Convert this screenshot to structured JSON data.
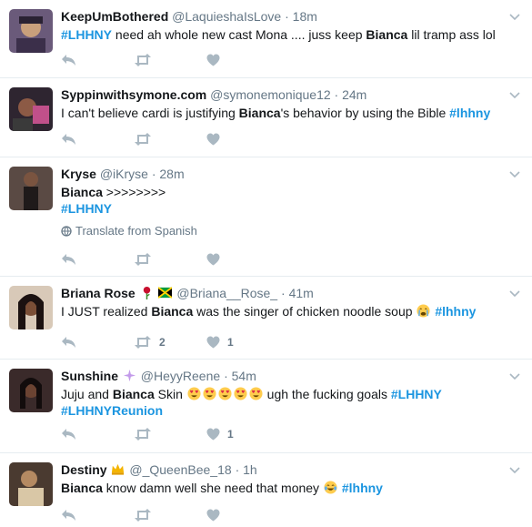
{
  "tweets": [
    {
      "name": "KeepUmBothered",
      "handle": "@LaquieshaIsLove",
      "time": "18m",
      "text": [
        {
          "t": "#LHHNY",
          "c": "hashtag"
        },
        {
          "t": " need ah whole new cast Mona .... juss keep "
        },
        {
          "t": "Bianca",
          "c": "b"
        },
        {
          "t": " lil tramp ass lol"
        }
      ],
      "retweets": "",
      "likes": ""
    },
    {
      "name": "Syppinwithsymone.com",
      "handle": "@symonemonique12",
      "time": "24m",
      "text": [
        {
          "t": "I can't believe cardi is justifying "
        },
        {
          "t": "Bianca",
          "c": "b"
        },
        {
          "t": "'s behavior by using the Bible "
        },
        {
          "t": "#lhhny",
          "c": "hashtag"
        }
      ],
      "retweets": "",
      "likes": ""
    },
    {
      "name": "Kryse",
      "handle": "@iKryse",
      "time": "28m",
      "text_line1": "Bianca",
      "text_line1_rest": " >>>>>>>>",
      "text_line2": "#LHHNY",
      "translate_label": "Translate from Spanish",
      "retweets": "",
      "likes": ""
    },
    {
      "name": "Briana Rose",
      "handle": "@Briana__Rose_",
      "time": "41m",
      "text": [
        {
          "t": "I JUST realized "
        },
        {
          "t": "Bianca",
          "c": "b"
        },
        {
          "t": " was the singer of chicken noodle soup "
        },
        {
          "emoji": "crying"
        },
        {
          "t": " "
        },
        {
          "t": "#lhhny",
          "c": "hashtag"
        }
      ],
      "retweets": "2",
      "likes": "1"
    },
    {
      "name": "Sunshine",
      "handle": "@HeyyReene",
      "time": "54m",
      "text_line1": [
        {
          "t": "Juju and "
        },
        {
          "t": "Bianca",
          "c": "b"
        },
        {
          "t": " Skin "
        },
        {
          "emoji": "hearteyes"
        },
        {
          "emoji": "hearteyes"
        },
        {
          "emoji": "hearteyes"
        },
        {
          "emoji": "hearteyes"
        },
        {
          "emoji": "hearteyes"
        },
        {
          "t": " ugh the fucking goals "
        },
        {
          "t": "#LHHNY",
          "c": "hashtag"
        }
      ],
      "text_line2": "#LHHNYReunion",
      "retweets": "",
      "likes": "1"
    },
    {
      "name": "Destiny",
      "handle": "@_QueenBee_18",
      "time": "1h",
      "text": [
        {
          "t": "Bianca",
          "c": "b"
        },
        {
          "t": " know damn well she need that money "
        },
        {
          "emoji": "laughing"
        },
        {
          "t": " "
        },
        {
          "t": "#lhhny",
          "c": "hashtag"
        }
      ],
      "retweets": "",
      "likes": ""
    }
  ],
  "colors": {
    "hashtag": "#1b95e0",
    "action": "#aab8c2",
    "divider": "#e6ecf0"
  },
  "icons": [
    "reply-icon",
    "retweet-icon",
    "like-icon",
    "caret-down-icon",
    "globe-icon",
    "rose-emoji",
    "jamaica-flag-emoji",
    "sparkles-emoji",
    "crown-emoji"
  ]
}
